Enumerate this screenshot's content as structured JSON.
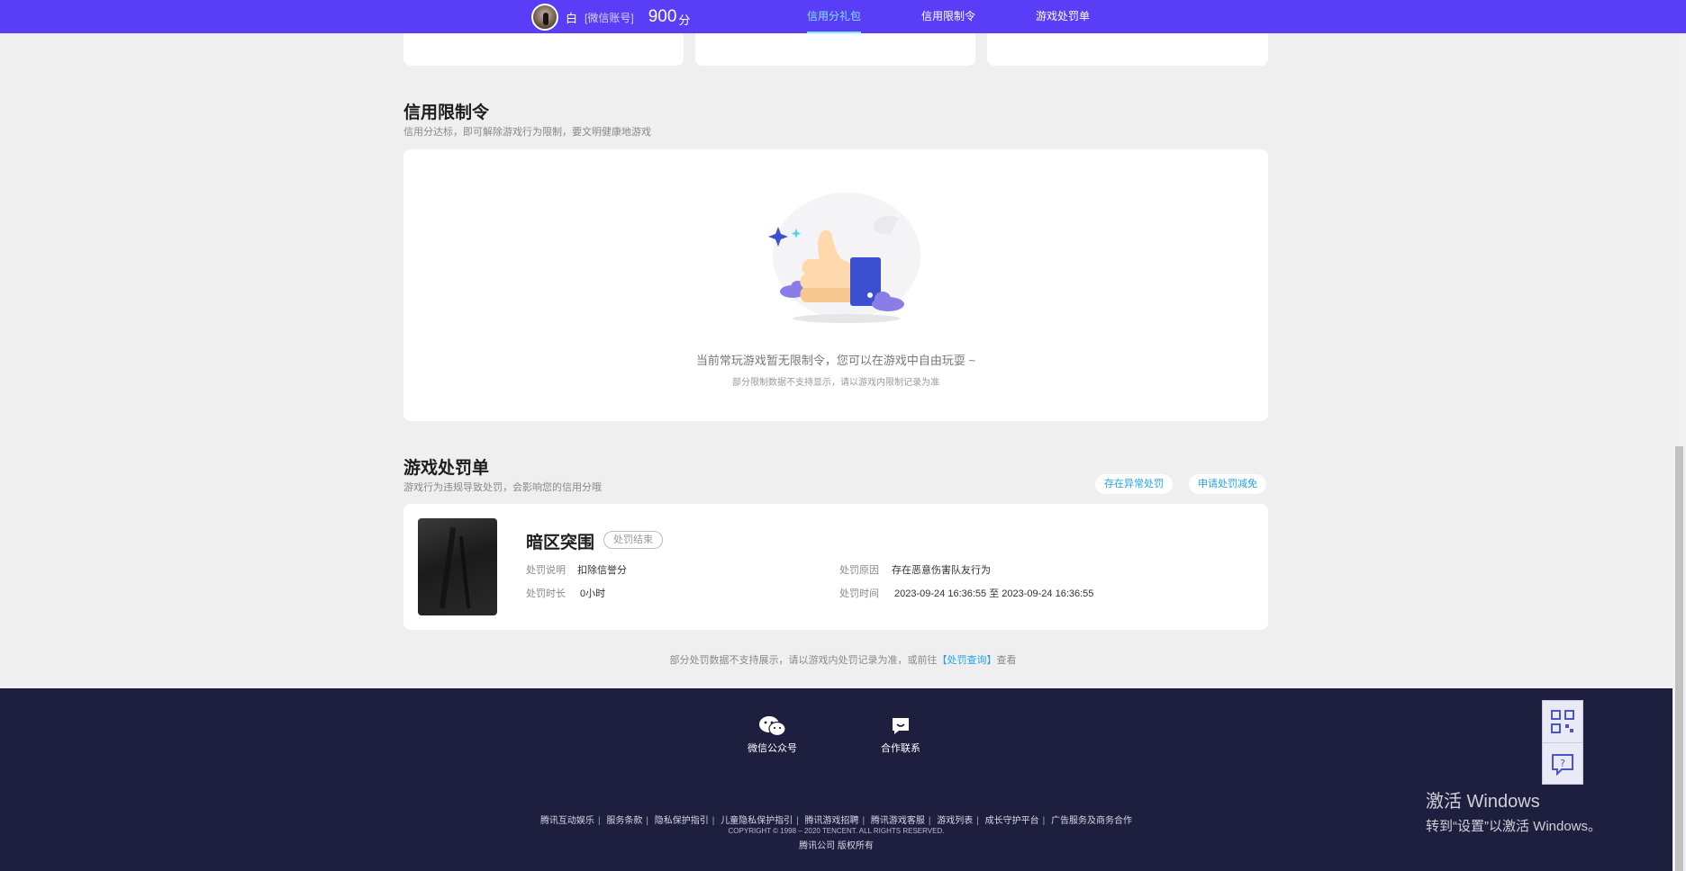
{
  "header": {
    "username": "白",
    "account_type": "[微信账号]",
    "score": "900",
    "score_unit": "分",
    "tabs": [
      {
        "label": "信用分礼包"
      },
      {
        "label": "信用限制令"
      },
      {
        "label": "游戏处罚单"
      }
    ],
    "active_tab": "信用分礼包"
  },
  "restriction": {
    "title": "信用限制令",
    "subtitle": "信用分达标，即可解除游戏行为限制，要文明健康地游戏",
    "empty_message": "当前常玩游戏暂无限制令，您可以在游戏中自由玩耍 ~",
    "empty_note": "部分限制数据不支持显示，请以游戏内限制记录为准"
  },
  "penalty": {
    "title": "游戏处罚单",
    "subtitle": "游戏行为违规导致处罚，会影响您的信用分哦",
    "buttons": {
      "report_abnormal": "存在异常处罚",
      "apply_reduction": "申请处罚减免"
    },
    "items": [
      {
        "game": "暗区突围",
        "status": "处罚结束",
        "desc_label": "处罚说明",
        "desc_value": "扣除信誉分",
        "duration_label": "处罚时长",
        "duration_value": "0小时",
        "reason_label": "处罚原因",
        "reason_value": "存在恶意伤害队友行为",
        "time_label": "处罚时间",
        "time_value": "2023-09-24 16:36:55 至 2023-09-24 16:36:55"
      }
    ],
    "footnote_prefix": "部分处罚数据不支持展示，请以游戏内处罚记录为准，或前往",
    "footnote_link": "【处罚查询】",
    "footnote_suffix": "查看"
  },
  "footer": {
    "wechat_label": "微信公众号",
    "cooperation_label": "合作联系",
    "links": [
      "腾讯互动娱乐",
      "服务条款",
      "隐私保护指引",
      "儿童隐私保护指引",
      "腾讯游戏招聘",
      "腾讯游戏客服",
      "游戏列表",
      "成长守护平台",
      "广告服务及商务合作"
    ],
    "copyright": "COPYRIGHT © 1998 – 2020 TENCENT. ALL RIGHTS RESERVED.",
    "rights": "腾讯公司 版权所有"
  },
  "watermark": {
    "line1": "激活 Windows",
    "line2": "转到“设置”以激活 Windows。"
  },
  "colors": {
    "header_bg": "#5a3df6",
    "active_tab": "#7fe6ff",
    "link": "#22a3e8",
    "footer_bg": "#1e1f3e",
    "page_bg": "#efefef"
  },
  "icons": {
    "avatar": "avatar",
    "wechat": "wechat-icon",
    "chat": "chat-icon",
    "qrcode": "qrcode-icon",
    "help": "help-icon"
  }
}
